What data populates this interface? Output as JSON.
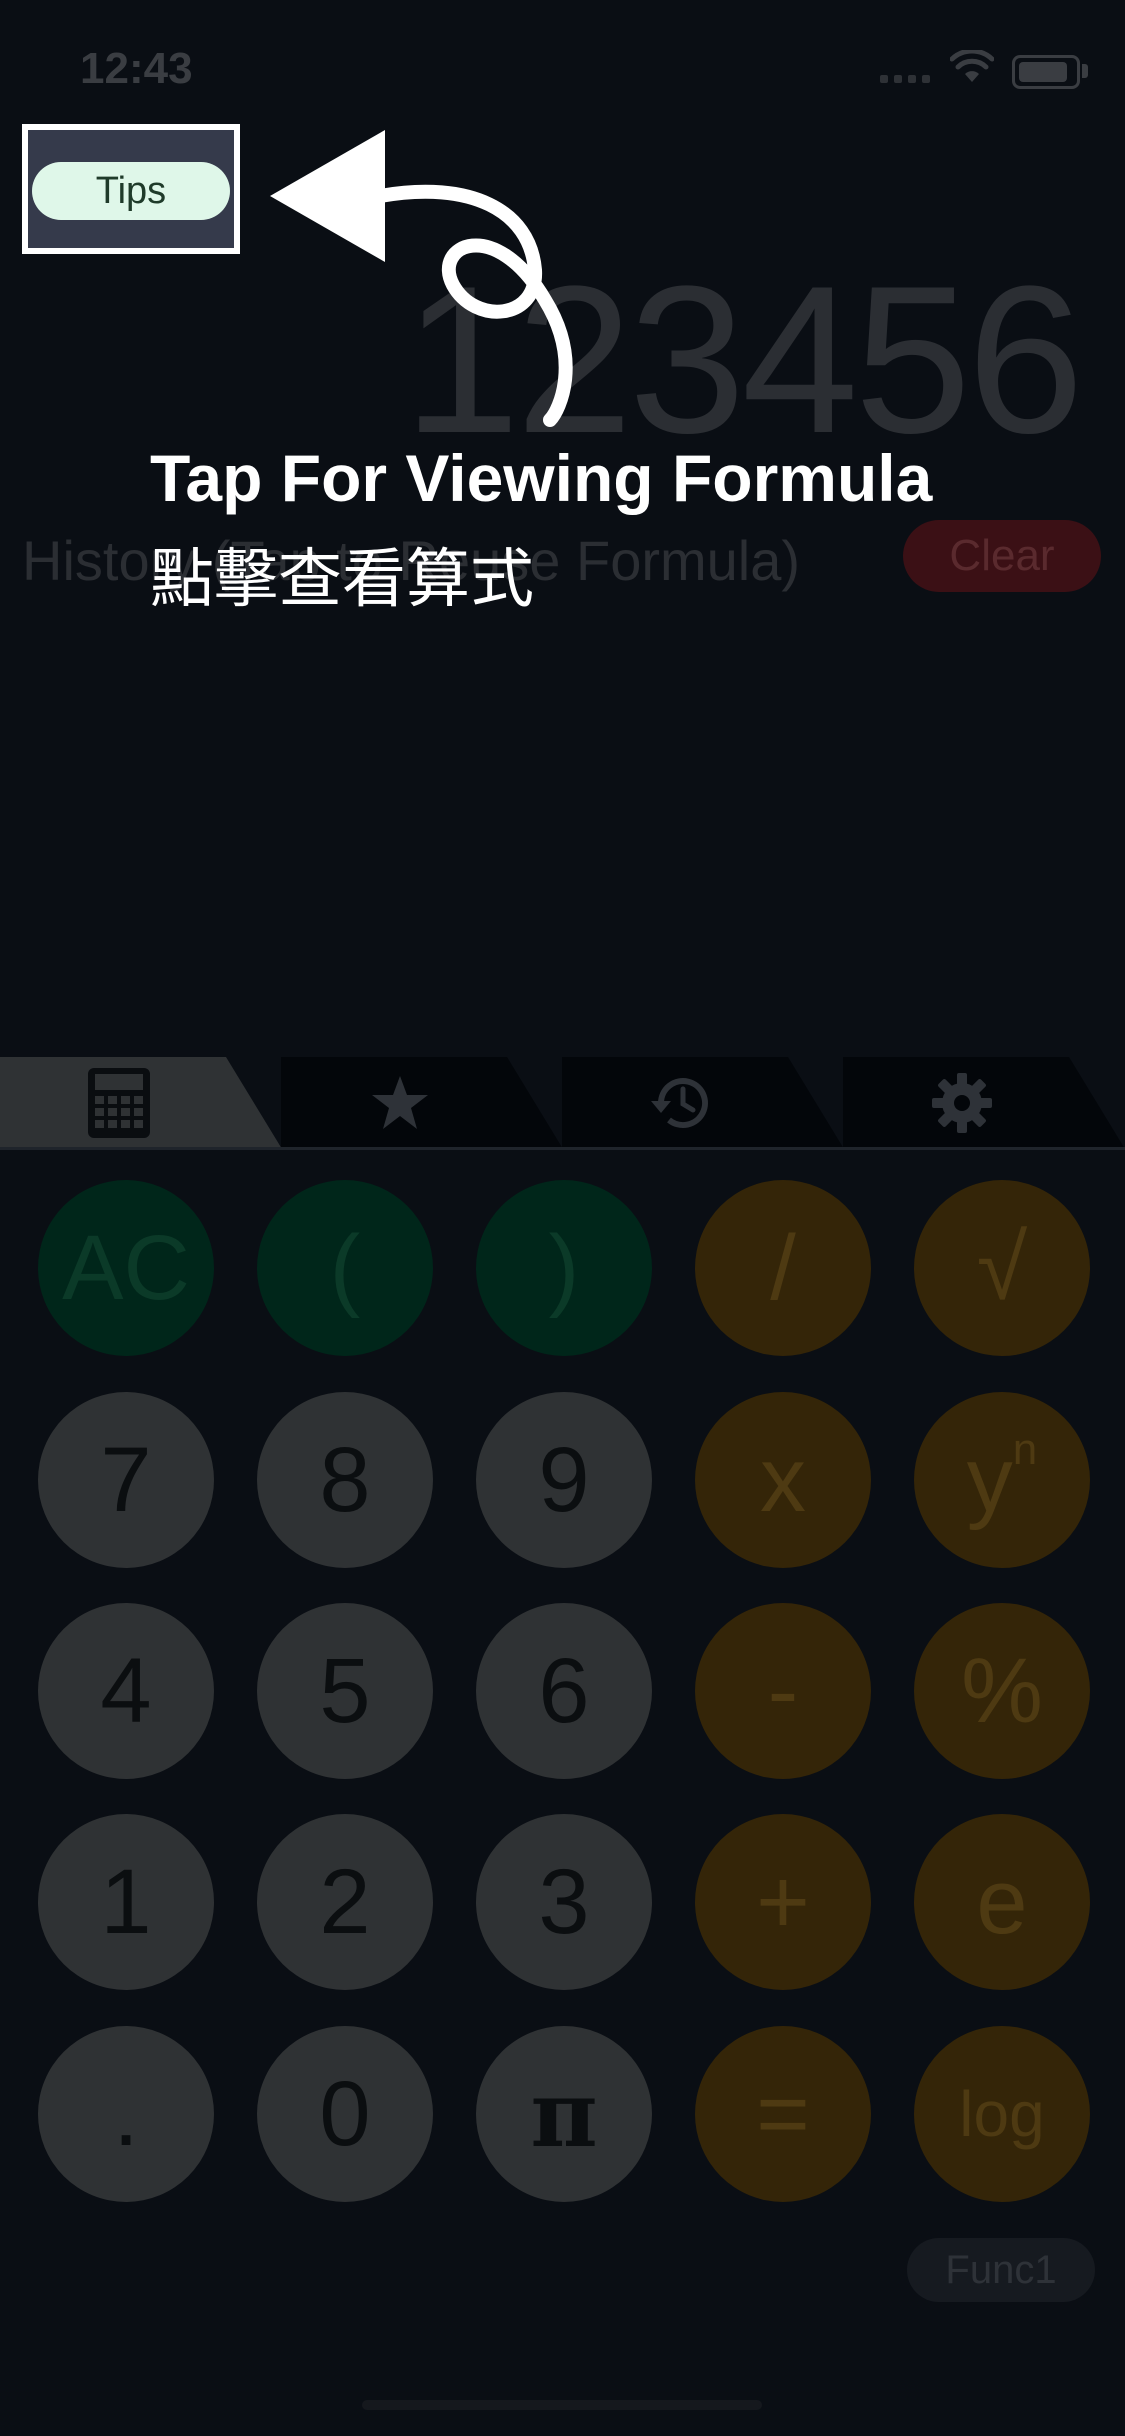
{
  "status_bar": {
    "time": "12:43"
  },
  "display": {
    "value": "123456"
  },
  "history": {
    "label": "History (Tap to Reuse Formula)",
    "clear_label": "Clear"
  },
  "overlay": {
    "tips_label": "Tips",
    "title": "Tap For Viewing Formula",
    "subtitle": "點擊查看算式"
  },
  "tabs": [
    {
      "icon": "calculator-icon",
      "active": true
    },
    {
      "icon": "star-icon",
      "active": false
    },
    {
      "icon": "history-icon",
      "active": false
    },
    {
      "icon": "gear-icon",
      "active": false
    }
  ],
  "keypad": {
    "rows": [
      [
        {
          "label": "AC",
          "style": "green"
        },
        {
          "label": "(",
          "style": "green"
        },
        {
          "label": ")",
          "style": "green"
        },
        {
          "label": "/",
          "style": "orange"
        },
        {
          "label": "√",
          "style": "orange"
        }
      ],
      [
        {
          "label": "7",
          "style": "gray"
        },
        {
          "label": "8",
          "style": "gray"
        },
        {
          "label": "9",
          "style": "gray"
        },
        {
          "label": "x",
          "style": "orange"
        },
        {
          "label": "y",
          "sup": "n",
          "style": "orange"
        }
      ],
      [
        {
          "label": "4",
          "style": "gray"
        },
        {
          "label": "5",
          "style": "gray"
        },
        {
          "label": "6",
          "style": "gray"
        },
        {
          "label": "-",
          "style": "orange"
        },
        {
          "label": "%",
          "style": "orange"
        }
      ],
      [
        {
          "label": "1",
          "style": "gray"
        },
        {
          "label": "2",
          "style": "gray"
        },
        {
          "label": "3",
          "style": "gray"
        },
        {
          "label": "+",
          "style": "orange"
        },
        {
          "label": "e",
          "style": "orange"
        }
      ],
      [
        {
          "label": ".",
          "style": "gray"
        },
        {
          "label": "0",
          "style": "gray"
        },
        {
          "label": "π",
          "style": "gray"
        },
        {
          "label": "=",
          "style": "orange"
        },
        {
          "label": "log",
          "style": "orange"
        }
      ]
    ]
  },
  "func_label": "Func1",
  "colors": {
    "background": "#0a0e14",
    "clear": "#3b1015",
    "tips": "#dff7e9",
    "green": "#00261a",
    "orange": "#342508"
  }
}
